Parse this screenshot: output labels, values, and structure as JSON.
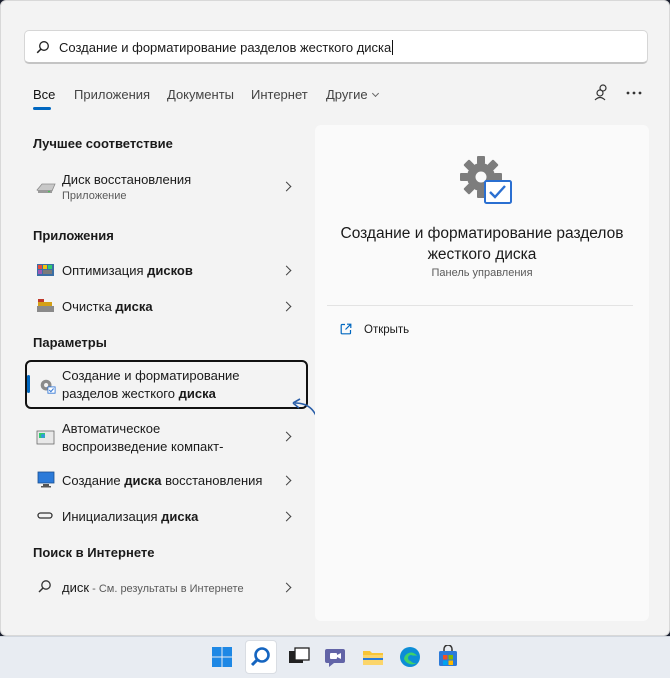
{
  "search": {
    "query": "Создание и форматирование разделов жесткого диска",
    "icon": "search-icon"
  },
  "tabs": [
    {
      "label": "Все",
      "active": true
    },
    {
      "label": "Приложения"
    },
    {
      "label": "Документы"
    },
    {
      "label": "Интернет"
    },
    {
      "label": "Другие"
    }
  ],
  "sections": {
    "best_match": "Лучшее соответствие",
    "apps": "Приложения",
    "settings": "Параметры",
    "web": "Поиск в Интернете"
  },
  "best_match": {
    "title": "Диск восстановления",
    "subtitle": "Приложение"
  },
  "apps": [
    {
      "pre": "Оптимизация ",
      "bold": "дисков",
      "post": ""
    },
    {
      "pre": "Очистка ",
      "bold": "диска",
      "post": ""
    }
  ],
  "settings": [
    {
      "line1": "Создание и форматирование",
      "line2_pre": "разделов жесткого ",
      "line2_bold": "диска"
    },
    {
      "line1": "Автоматическое",
      "line2": "воспроизведение компакт-"
    },
    {
      "pre": "Создание ",
      "bold": "диска",
      "post": " восстановления"
    },
    {
      "pre": "Инициализация ",
      "bold": "диска",
      "post": ""
    }
  ],
  "web": {
    "bold": "диск",
    "rest": " - См. результаты в Интернете"
  },
  "detail": {
    "title": "Создание и форматирование разделов жесткого диска",
    "subtitle": "Панель управления",
    "open_label": "Открыть"
  },
  "colors": {
    "accent": "#0067c0",
    "panel": "#f3f3f3",
    "detail": "#fafafa"
  },
  "taskbar": [
    "windows-start-icon",
    "search-icon",
    "task-view-icon",
    "teams-chat-icon",
    "file-explorer-icon",
    "edge-icon",
    "store-icon"
  ]
}
